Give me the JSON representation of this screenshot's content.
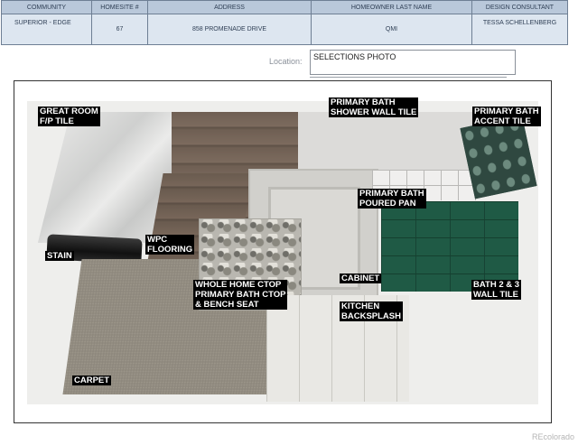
{
  "header": {
    "columns": [
      "COMMUNITY",
      "HOMESITE #",
      "ADDRESS",
      "HOMEOWNER LAST NAME",
      "DESIGN CONSULTANT"
    ],
    "values": [
      "SUPERIOR - EDGE",
      "67",
      "858 PROMENADE DRIVE",
      "QMI",
      "TESSA SCHELLENBERG"
    ]
  },
  "location": {
    "label": "Location:",
    "value": "SELECTIONS PHOTO"
  },
  "labels": {
    "great_room": "GREAT ROOM\nF/P TILE",
    "primary_bath_shower": "PRIMARY BATH\nSHOWER WALL TILE",
    "primary_bath_accent": "PRIMARY BATH\nACCENT TILE",
    "primary_bath_pan": "PRIMARY BATH\nPOURED PAN",
    "wpc": "WPC\nFLOORING",
    "stain": "STAIN",
    "cabinet": "CABINET",
    "bath_wall": "BATH 2 & 3\nWALL TILE",
    "ctop": "WHOLE HOME CTOP\nPRIMARY BATH CTOP\n& BENCH SEAT",
    "backsplash": "KITCHEN\nBACKSPLASH",
    "carpet": "CARPET"
  },
  "colors": {
    "header_bg": "#b9c8da",
    "value_bg": "#dde6f0",
    "border": "#6e7f94",
    "label_bg": "#000000"
  },
  "brand": "REcolorado"
}
